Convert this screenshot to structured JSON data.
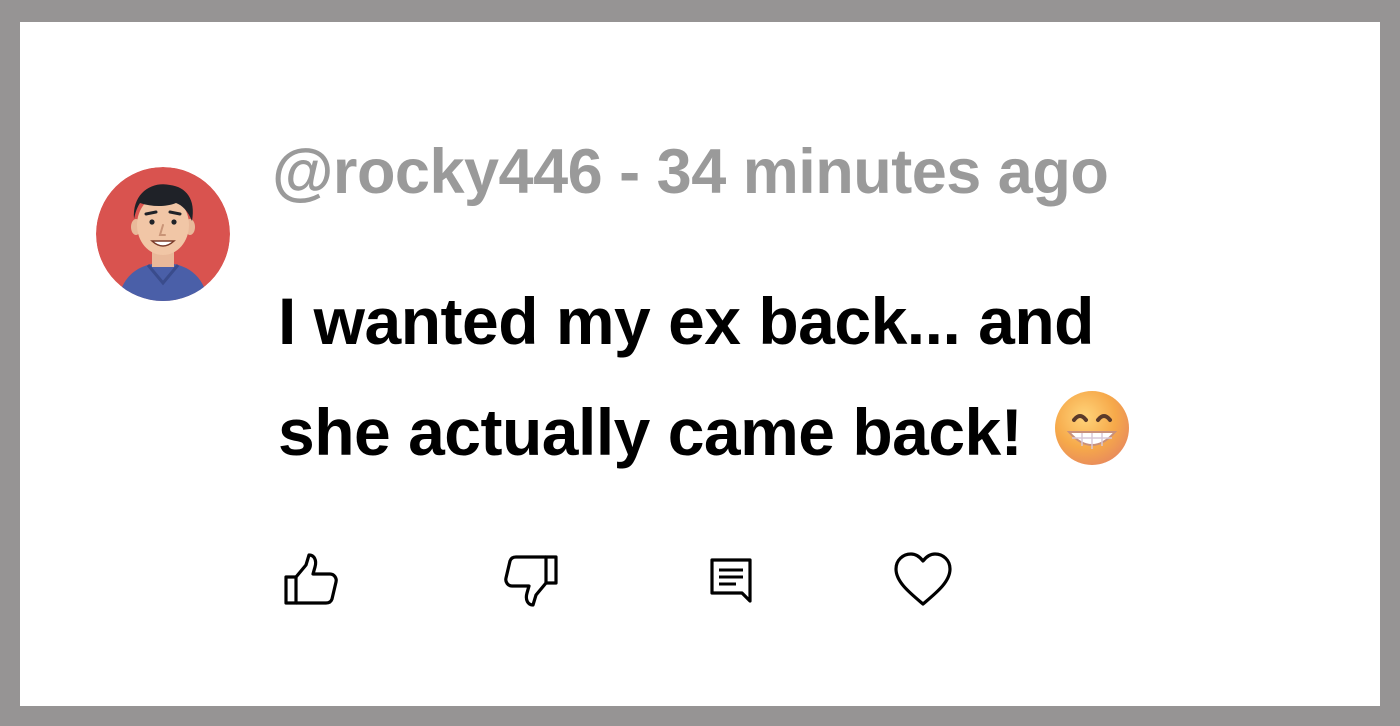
{
  "comment": {
    "username": "@rocky446",
    "separator": " - ",
    "timestamp": "34 minutes ago",
    "text_line1": "I wanted my ex back... and",
    "text_line2": "she actually came back!",
    "emoji": "grinning-face-with-smiling-eyes"
  },
  "actions": [
    {
      "name": "like",
      "icon": "thumbs-up-icon"
    },
    {
      "name": "dislike",
      "icon": "thumbs-down-icon"
    },
    {
      "name": "reply",
      "icon": "comment-icon"
    },
    {
      "name": "favorite",
      "icon": "heart-icon"
    }
  ],
  "colors": {
    "frame": "#969494",
    "card": "#ffffff",
    "meta_text": "#9a9a9a",
    "body_text": "#000000",
    "avatar_bg": "#d9534f"
  }
}
